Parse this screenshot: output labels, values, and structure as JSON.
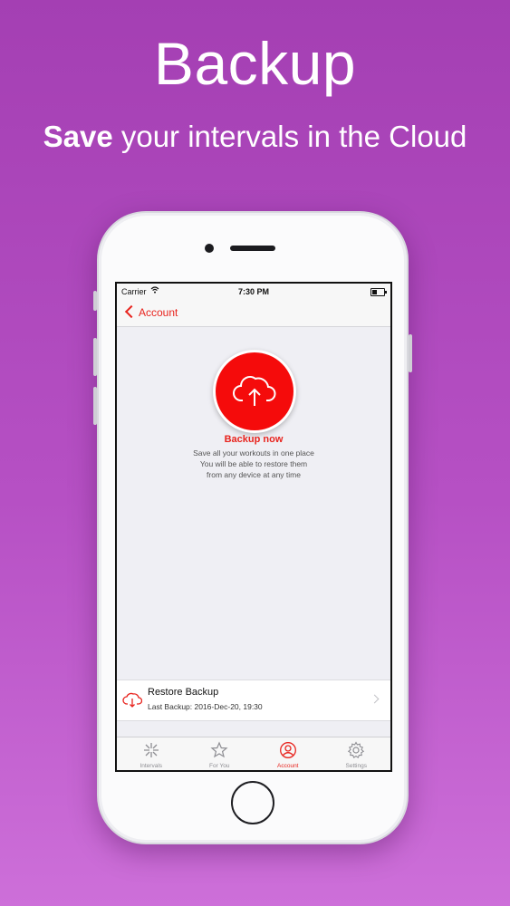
{
  "headline": "Backup",
  "subline": {
    "bold": "Save",
    "rest": " your intervals in the Cloud"
  },
  "status_bar": {
    "carrier": "Carrier",
    "time": "7:30 PM",
    "battery_level": 0.4
  },
  "nav": {
    "back_label": "Account"
  },
  "backup": {
    "title": "Backup now",
    "description_lines": [
      "Save all your workouts in one place",
      "You will be able to restore them",
      "from any device at any time"
    ]
  },
  "restore": {
    "title": "Restore Backup",
    "subtitle": "Last Backup: 2016-Dec-20, 19:30"
  },
  "tabs": [
    {
      "label": "Intervals",
      "icon": "intervals-icon",
      "active": false
    },
    {
      "label": "For You",
      "icon": "star-icon",
      "active": false
    },
    {
      "label": "Account",
      "icon": "account-icon",
      "active": true
    },
    {
      "label": "Settings",
      "icon": "gear-icon",
      "active": false
    }
  ],
  "colors": {
    "accent": "#e8241e",
    "background_top": "#a43fb3",
    "background_bottom": "#cd6fd9",
    "button_red": "#f50b0b"
  }
}
